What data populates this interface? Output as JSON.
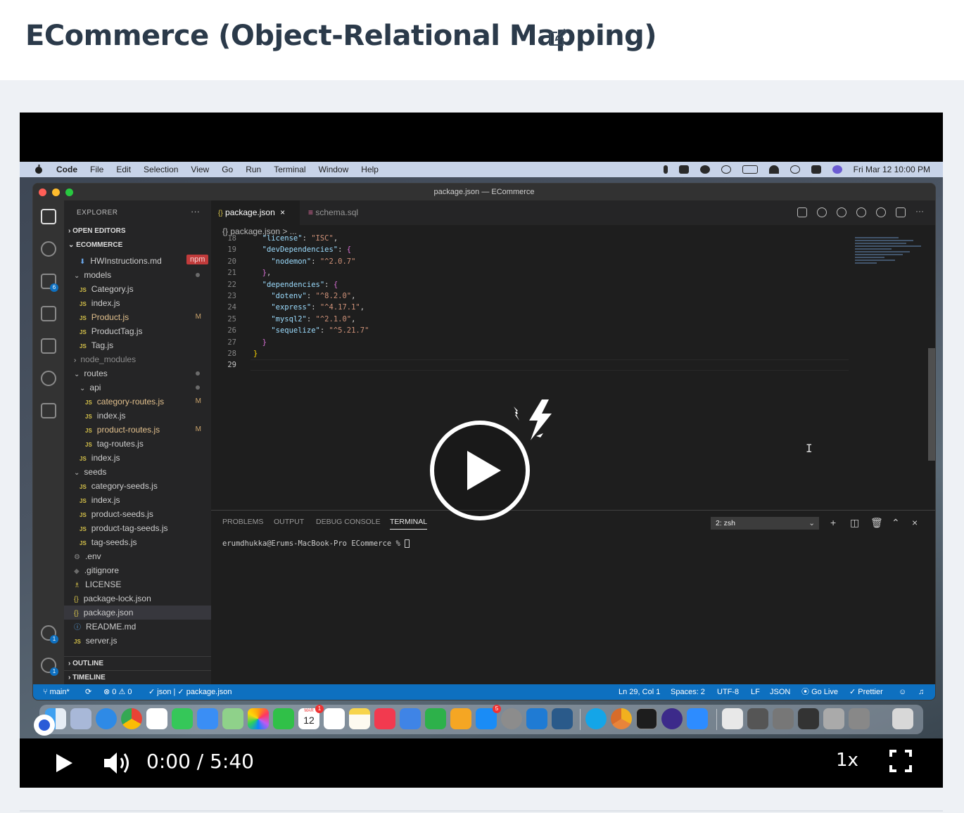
{
  "page": {
    "title": "ECommerce (Object-Relational Mapping)"
  },
  "macos": {
    "menus": [
      "Code",
      "File",
      "Edit",
      "Selection",
      "View",
      "Go",
      "Run",
      "Terminal",
      "Window",
      "Help"
    ],
    "clock": "Fri Mar 12  10:00 PM"
  },
  "window": {
    "title": "package.json — ECommerce"
  },
  "sidebar": {
    "title": "EXPLORER",
    "more": "···",
    "open_editors": "OPEN EDITORS",
    "project": "ECOMMERCE",
    "npm_badge": "npm",
    "outline": "OUTLINE",
    "timeline": "TIMELINE",
    "scm_badge": "6",
    "accounts_badge": "1",
    "settings_badge": "1",
    "files": [
      {
        "name": "HWInstructions.md",
        "type": "md"
      },
      {
        "name": "models",
        "type": "folder-open"
      },
      {
        "name": "Category.js",
        "type": "js"
      },
      {
        "name": "index.js",
        "type": "js"
      },
      {
        "name": "Product.js",
        "type": "js",
        "mark": "M"
      },
      {
        "name": "ProductTag.js",
        "type": "js"
      },
      {
        "name": "Tag.js",
        "type": "js"
      },
      {
        "name": "node_modules",
        "type": "folder"
      },
      {
        "name": "routes",
        "type": "folder-open"
      },
      {
        "name": "api",
        "type": "folder-open"
      },
      {
        "name": "category-routes.js",
        "type": "js",
        "mark": "M"
      },
      {
        "name": "index.js",
        "type": "js"
      },
      {
        "name": "product-routes.js",
        "type": "js",
        "mark": "M"
      },
      {
        "name": "tag-routes.js",
        "type": "js"
      },
      {
        "name": "index.js",
        "type": "js"
      },
      {
        "name": "seeds",
        "type": "folder-open"
      },
      {
        "name": "category-seeds.js",
        "type": "js"
      },
      {
        "name": "index.js",
        "type": "js"
      },
      {
        "name": "product-seeds.js",
        "type": "js"
      },
      {
        "name": "product-tag-seeds.js",
        "type": "js"
      },
      {
        "name": "tag-seeds.js",
        "type": "js"
      },
      {
        "name": ".env",
        "type": "env"
      },
      {
        "name": ".gitignore",
        "type": "git"
      },
      {
        "name": "LICENSE",
        "type": "license"
      },
      {
        "name": "package-lock.json",
        "type": "json"
      },
      {
        "name": "package.json",
        "type": "json"
      },
      {
        "name": "README.md",
        "type": "info"
      },
      {
        "name": "server.js",
        "type": "js"
      }
    ]
  },
  "editor": {
    "tabs": [
      {
        "label": "package.json",
        "close": "×"
      },
      {
        "label": "schema.sql"
      }
    ],
    "breadcrumb": "{} package.json > ...",
    "code": [
      {
        "n": "18",
        "text": "  \"license\": \"ISC\","
      },
      {
        "n": "19",
        "text": "  \"devDependencies\": {"
      },
      {
        "n": "20",
        "text": "    \"nodemon\": \"^2.0.7\""
      },
      {
        "n": "21",
        "text": "  },"
      },
      {
        "n": "22",
        "text": "  \"dependencies\": {"
      },
      {
        "n": "23",
        "text": "    \"dotenv\": \"^8.2.0\","
      },
      {
        "n": "24",
        "text": "    \"express\": \"^4.17.1\","
      },
      {
        "n": "25",
        "text": "    \"mysql2\": \"^2.1.0\","
      },
      {
        "n": "26",
        "text": "    \"sequelize\": \"^5.21.7\""
      },
      {
        "n": "27",
        "text": "  }"
      },
      {
        "n": "28",
        "text": "}"
      },
      {
        "n": "29",
        "text": ""
      }
    ]
  },
  "panel": {
    "tabs": [
      "PROBLEMS",
      "OUTPUT",
      "DEBUG CONSOLE",
      "TERMINAL"
    ],
    "terminal_select": "2: zsh",
    "prompt": "erumdhukka@Erums-MacBook-Pro ECommerce % "
  },
  "statusbar": {
    "branch": "main*",
    "errors": "⊗ 0 ⚠ 0",
    "lang_check": "✓ json | ✓ package.json",
    "position": "Ln 29, Col 1",
    "spaces": "Spaces: 2",
    "encoding": "UTF-8",
    "eol": "LF",
    "language": "JSON",
    "golive": "Go Live",
    "prettier": "✓ Prettier"
  },
  "dock": {
    "calendar_month": "MAR",
    "calendar_day": "12",
    "appstore_badge": "5",
    "calendar_badge": "1"
  },
  "player": {
    "time": "0:00 / 5:40",
    "speed": "1x",
    "progress": 0
  }
}
